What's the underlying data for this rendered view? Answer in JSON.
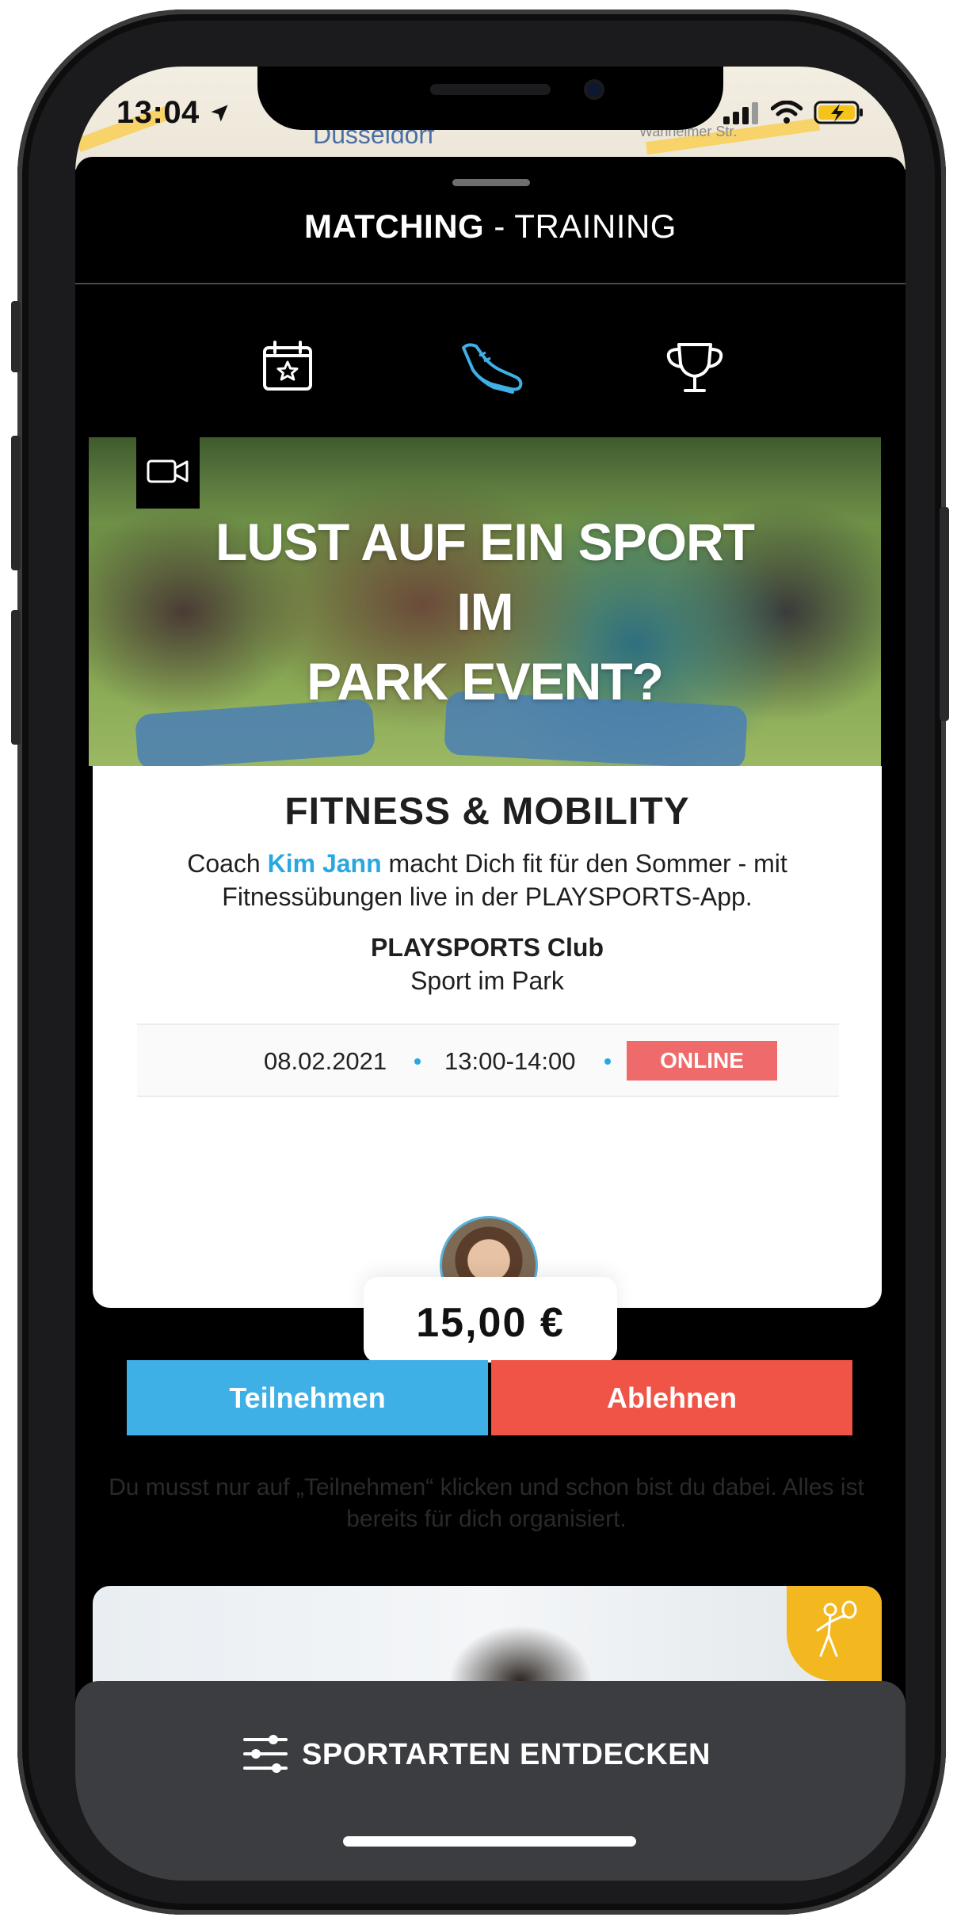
{
  "status_bar": {
    "time": "13:04",
    "map_label_city": "Düsseldorf",
    "map_label_street": "Wanheimer Str."
  },
  "header": {
    "title_bold": "MATCHING",
    "title_rest": " - TRAINING"
  },
  "tabs": [
    {
      "icon": "calendar-star-icon"
    },
    {
      "icon": "running-shoe-icon",
      "active": true
    },
    {
      "icon": "trophy-icon"
    }
  ],
  "hero": {
    "title_line1": "LUST AUF EIN SPORT",
    "title_line2": "IM",
    "title_line3": "PARK EVENT?"
  },
  "event": {
    "title": "FITNESS & MOBILITY",
    "desc_prefix": "Coach ",
    "coach_name": "Kim Jann",
    "desc_suffix": " macht Dich fit für den Sommer - mit Fitnessübungen live in der PLAYSPORTS-App.",
    "club_name": "PLAYSPORTS Club",
    "club_sub": "Sport im Park",
    "date": "08.02.2021",
    "time": "13:00-14:00",
    "badge": "ONLINE",
    "price": "15,00 €"
  },
  "actions": {
    "join": "Teilnehmen",
    "decline": "Ablehnen",
    "hint": "Du musst nur auf „Teilnehmen“ klicken und schon bist du dabei. Alles ist bereits für dich organisiert."
  },
  "bottom_bar": {
    "label": "SPORTARTEN ENTDECKEN"
  },
  "colors": {
    "accent_blue": "#3fb0e6",
    "decline_red": "#f05446",
    "online_badge": "#ef6b6b",
    "coach_link": "#29a8e0",
    "tennis_badge": "#f3b81f"
  }
}
